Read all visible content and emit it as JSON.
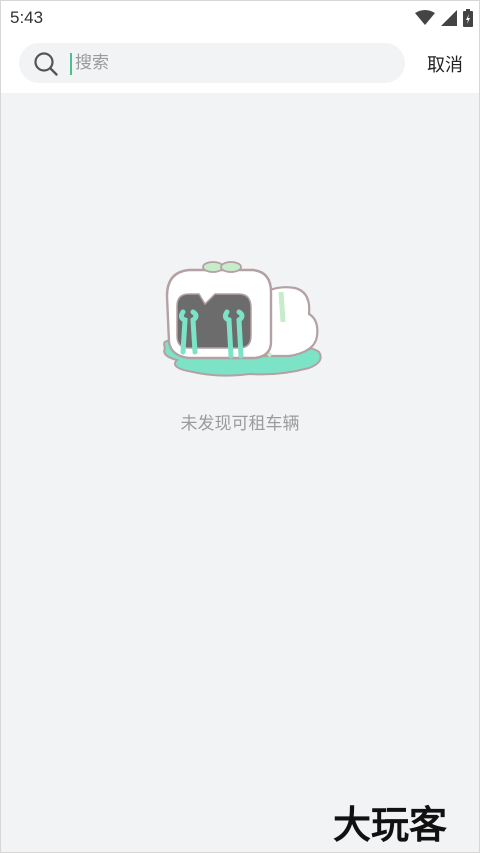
{
  "status_bar": {
    "time": "5:43",
    "icons": [
      "wifi-icon",
      "signal-icon",
      "battery-icon"
    ]
  },
  "search": {
    "placeholder": "搜索",
    "value": "",
    "cancel_label": "取消"
  },
  "empty_state": {
    "message": "未发现可租车辆",
    "illustration": "crying-tofu-icon"
  },
  "watermark": {
    "text": "大玩客"
  },
  "colors": {
    "background": "#f2f3f5",
    "accent": "#4cbf8f",
    "tear": "#7ce3c7"
  }
}
